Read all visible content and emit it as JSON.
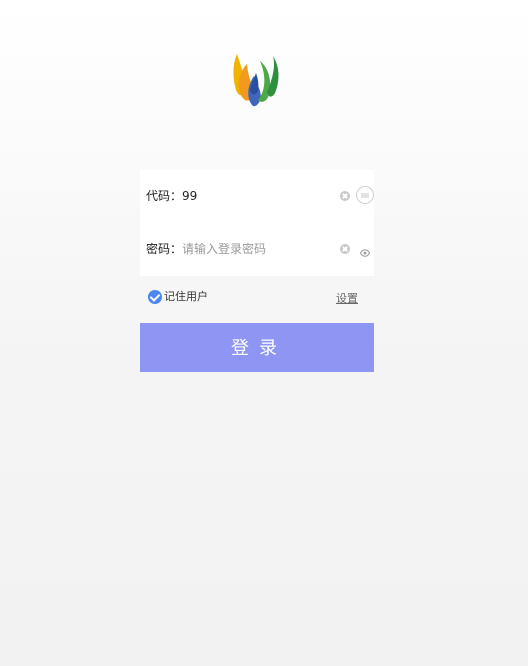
{
  "app": {
    "logo_icon": "flame-logo-icon"
  },
  "form": {
    "code": {
      "label": "代码：",
      "value": "99"
    },
    "password": {
      "label": "密码：",
      "placeholder": "请输入登录密码"
    }
  },
  "options": {
    "remember_label": "记住用户",
    "remember_checked": true,
    "settings_label": "设置"
  },
  "actions": {
    "login_label": "登录"
  },
  "colors": {
    "primary_button": "#8f95f2",
    "checkbox": "#4b87ef",
    "clear_icon": "#c8c8c8"
  }
}
